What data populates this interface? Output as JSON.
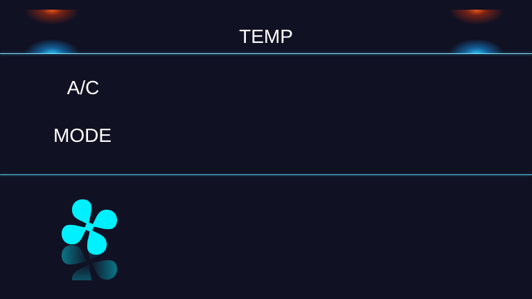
{
  "header": {
    "title": "TEMP"
  },
  "controls": {
    "ac_label": "A/C",
    "mode_label": "MODE"
  },
  "fan": {
    "icon": "fan-icon",
    "color": "#00f0ff"
  },
  "colors": {
    "background": "#111124",
    "accent": "#7fe6ff",
    "heat_glow": "#ff5a14",
    "cool_glow": "#28c8ff"
  }
}
